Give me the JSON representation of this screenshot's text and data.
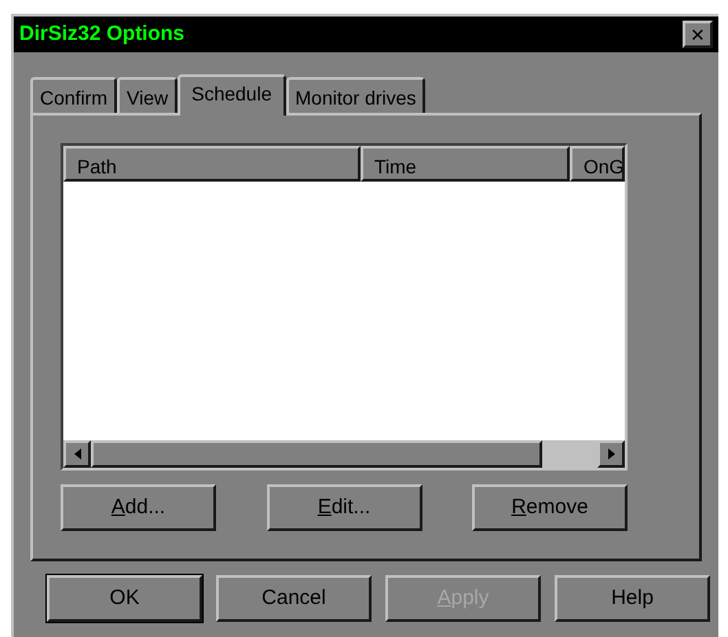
{
  "window": {
    "title": "DirSiz32 Options",
    "close": "✕"
  },
  "tabs": [
    {
      "label": "Confirm",
      "selected": false
    },
    {
      "label": "View",
      "selected": false
    },
    {
      "label": "Schedule",
      "selected": true
    },
    {
      "label": "Monitor drives",
      "selected": false
    }
  ],
  "table": {
    "columns": [
      "Path",
      "Time",
      "OnG"
    ]
  },
  "list_buttons": [
    {
      "label": "Add...",
      "mnemonic_underlined": true,
      "disabled": false
    },
    {
      "label": "Edit...",
      "mnemonic_underlined": true,
      "disabled": false
    },
    {
      "label": "Remove",
      "mnemonic_underlined": true,
      "disabled": false
    }
  ],
  "dialog_buttons": [
    {
      "label": "OK",
      "mnemonic_underlined": false,
      "disabled": false,
      "default": true
    },
    {
      "label": "Cancel",
      "mnemonic_underlined": false,
      "disabled": false,
      "default": false
    },
    {
      "label": "Apply",
      "mnemonic_underlined": true,
      "disabled": true,
      "default": false
    },
    {
      "label": "Help",
      "mnemonic_underlined": false,
      "disabled": false,
      "default": false
    }
  ]
}
